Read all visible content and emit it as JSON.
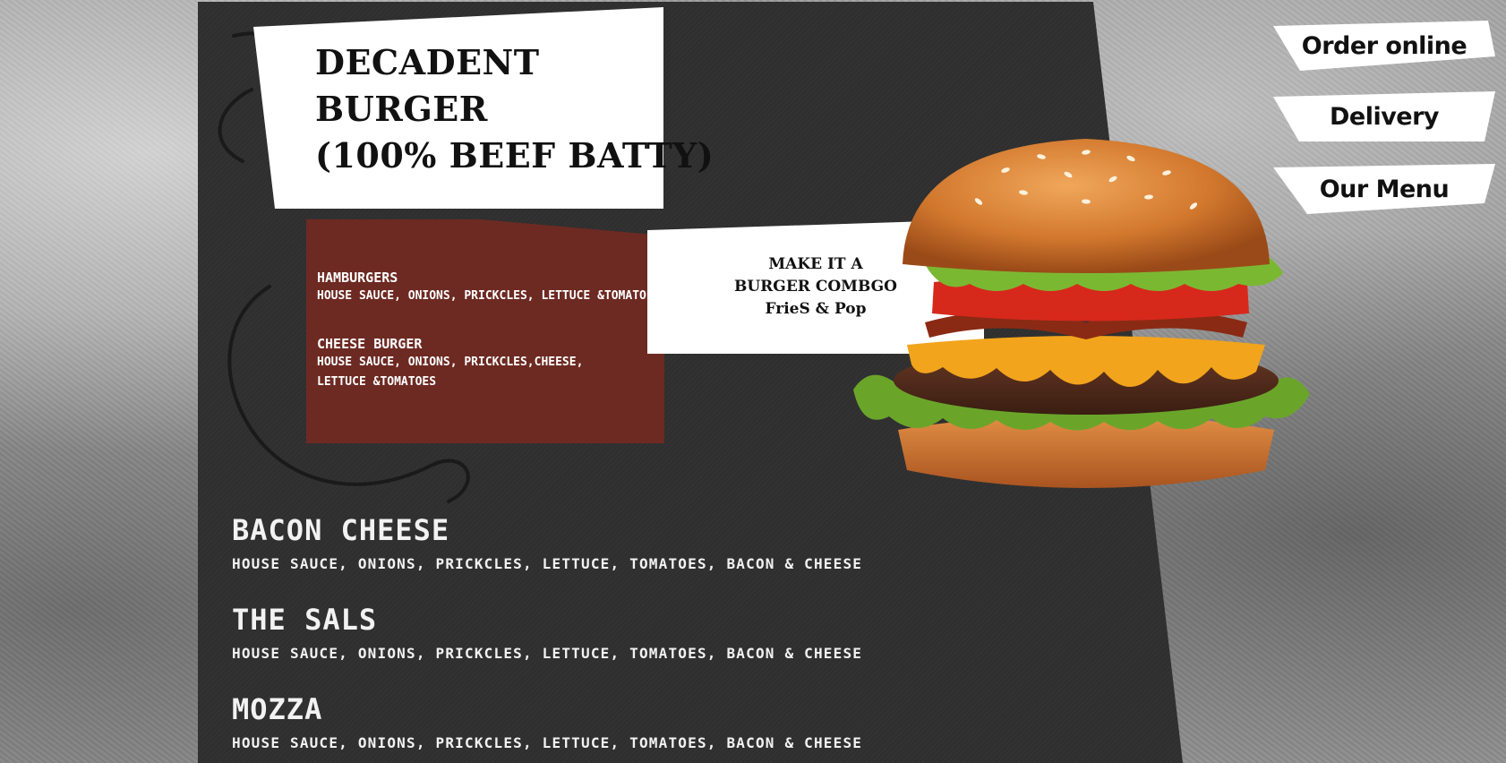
{
  "hero": {
    "title_lines": [
      "DECADENT",
      "BURGER",
      "(100% BEEF BATTY)"
    ]
  },
  "menu_card": {
    "items": [
      {
        "name": "HAMBURGERS",
        "desc": "HOUSE SAUCE, ONIONS, PRICKCLES, LETTUCE &TOMATOES"
      },
      {
        "name": "CHEESE BURGER",
        "desc": "HOUSE SAUCE, ONIONS, PRICKCLES,CHEESE, LETTUCE &TOMATOES"
      }
    ]
  },
  "combo": {
    "lines": [
      "MAKE IT A",
      "BURGER COMBGO",
      "FrieS & Pop"
    ]
  },
  "nav": {
    "order_online": "Order online",
    "delivery": "Delivery",
    "our_menu": "Our Menu"
  },
  "featured": [
    {
      "name": "BACON CHEESE",
      "desc": "HOUSE SAUCE, ONIONS, PRICKCLES, LETTUCE, TOMATOES, BACON & CHEESE"
    },
    {
      "name": "THE SALS",
      "desc": "HOUSE SAUCE, ONIONS, PRICKCLES, LETTUCE, TOMATOES, BACON & CHEESE"
    },
    {
      "name": "MOZZA",
      "desc": "HOUSE SAUCE, ONIONS, PRICKCLES, LETTUCE, TOMATOES, BACON & CHEESE"
    }
  ],
  "colors": {
    "panel": "#2f2f2f",
    "red_card": "#6d2a22",
    "white": "#ffffff"
  }
}
